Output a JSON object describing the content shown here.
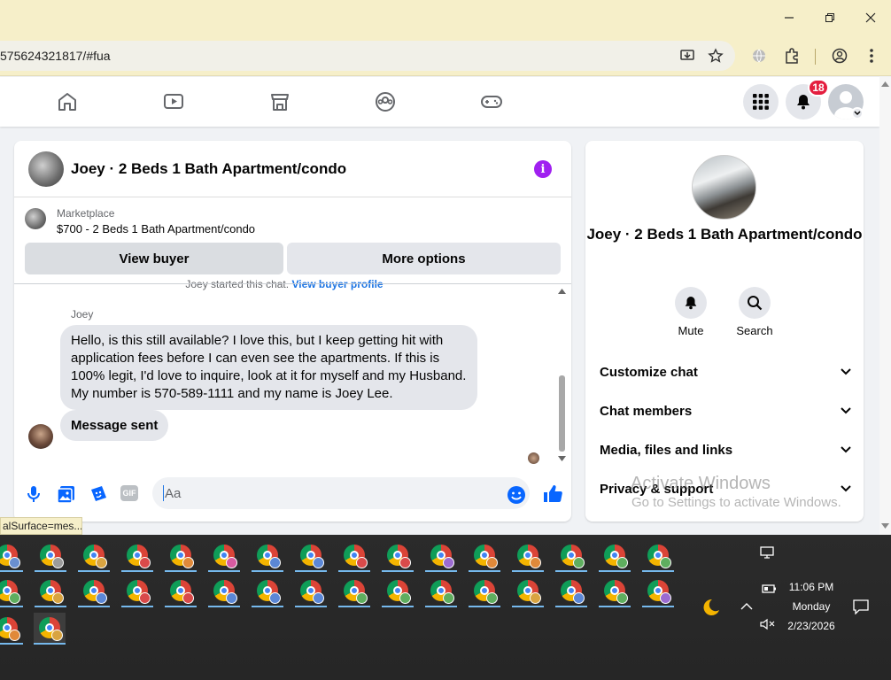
{
  "browser": {
    "url": "575624321817/#fua",
    "status_url": "alSurface=mes..."
  },
  "nav": {
    "notifications_count": "18"
  },
  "chat": {
    "title": "Joey · 2 Beds 1 Bath Apartment/condo",
    "marketplace_label": "Marketplace",
    "listing": "$700 - 2 Beds 1 Bath Apartment/condo",
    "view_buyer": "View buyer",
    "more_options": "More options",
    "started_text": "Joey started this chat.",
    "view_buyer_profile": "View buyer profile",
    "sender": "Joey",
    "message1": "Hello, is this still available? I love this, but I keep getting hit with application fees before I can even see the apartments. If this is 100% legit, I'd love to inquire, look at it for myself and my Husband. My number is 570-589-1111 and my name is Joey Lee.",
    "message2": "Message sent",
    "input_placeholder": "Aa",
    "gif_label": "GIF"
  },
  "details": {
    "title": "Joey · 2 Beds 1 Bath Apartment/condo",
    "mute": "Mute",
    "search": "Search",
    "sections": [
      "Customize chat",
      "Chat members",
      "Media, files and links",
      "Privacy & support"
    ]
  },
  "watermark": {
    "line1": "Activate Windows",
    "line2": "Go to Settings to activate Windows."
  },
  "taskbar": {
    "time": "11:06 PM",
    "day": "Monday",
    "date": "2/23/2026",
    "profile_colors_row1": [
      "#6a8fd0",
      "#9b9b9b",
      "#d9a441",
      "#d94a4a",
      "#e0893a",
      "#d85aa0",
      "#5b87d6",
      "#5b87d6",
      "#d94a4a",
      "#d94a4a",
      "#9b6bd1",
      "#e0893a",
      "#e0893a",
      "#5fae5f",
      "#5fae5f",
      "#5fae5f"
    ],
    "profile_colors_row2": [
      "#5fae5f",
      "#d9a441",
      "#5b87d6",
      "#d94a4a",
      "#d94a4a",
      "#5b87d6",
      "#5b87d6",
      "#5b87d6",
      "#5fae5f",
      "#5fae5f",
      "#5fae5f",
      "#5fae5f",
      "#d9a441",
      "#5b87d6",
      "#5fae5f",
      "#9b6bd1"
    ],
    "profile_colors_row3": [
      "#e0893a",
      "#d9a441"
    ]
  }
}
